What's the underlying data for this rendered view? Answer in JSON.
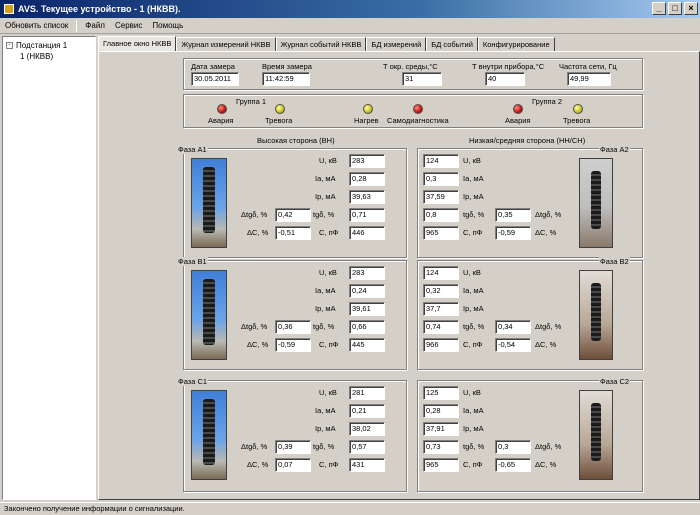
{
  "window": {
    "title": "AVS. Текущее устройство - 1 (НКВВ).",
    "buttons": [
      "_",
      "□",
      "×"
    ]
  },
  "menu": {
    "refresh": "Обновить список",
    "items": [
      "Файл",
      "Сервис",
      "Помощь"
    ]
  },
  "tree": {
    "root": "Подстанция 1",
    "root_toggle": "-",
    "child": "1 (НКВВ)"
  },
  "tabs": [
    "Главное окно НКВВ",
    "Журнал измерений НКВВ",
    "Журнал событий НКВВ",
    "БД измерений",
    "БД событий",
    "Конфигурирование"
  ],
  "header": {
    "date_label": "Дата замера",
    "date": "30.05.2011",
    "time_label": "Время замера",
    "time": "11:42:59",
    "tenv_label": "Т окр. среды,°С",
    "tenv": "31",
    "tdev_label": "Т внутри прибора,°С",
    "tdev": "40",
    "freq_label": "Частота сети, Гц",
    "freq": "49,99"
  },
  "signals": {
    "group1": "Группа 1",
    "group2": "Группа 2",
    "alarm": "Авария",
    "warning": "Тревога",
    "heating": "Нагрев",
    "selfdiag": "Самодиагностика",
    "colors": {
      "red": "#c0150e",
      "yellow": "#c8c020"
    }
  },
  "sides": {
    "high": "Высокая сторона (ВН)",
    "low": "Низкая/средняя сторона (НН/СН)"
  },
  "labels": {
    "u": "U, кВ",
    "ia": "Ia, мА",
    "ip": "Ip, мА",
    "tg": "tgδ, %",
    "c": "С, пФ",
    "dtg": "Δtgδ, %",
    "dc": "ΔС, %"
  },
  "phases": [
    {
      "hv_name": "Фаза А1",
      "lv_name": "Фаза А2",
      "hv": {
        "u": "283",
        "ia": "0,28",
        "ip": "39,63",
        "tg": "0,71",
        "c": "446",
        "dtg": "0,42",
        "dc": "-0,51"
      },
      "lv": {
        "u": "124",
        "ia": "0,3",
        "ip": "37,59",
        "tg": "0,8",
        "c": "965",
        "dtg": "0,35",
        "dc": "-0,59"
      }
    },
    {
      "hv_name": "Фаза В1",
      "lv_name": "Фаза В2",
      "hv": {
        "u": "283",
        "ia": "0,24",
        "ip": "39,61",
        "tg": "0,66",
        "c": "445",
        "dtg": "0,36",
        "dc": "-0,59"
      },
      "lv": {
        "u": "124",
        "ia": "0,32",
        "ip": "37,7",
        "tg": "0,74",
        "c": "966",
        "dtg": "0,34",
        "dc": "-0,54"
      }
    },
    {
      "hv_name": "Фаза С1",
      "lv_name": "Фаза С2",
      "hv": {
        "u": "281",
        "ia": "0,21",
        "ip": "38,02",
        "tg": "0,57",
        "c": "431",
        "dtg": "0,39",
        "dc": "0,07"
      },
      "lv": {
        "u": "125",
        "ia": "0,28",
        "ip": "37,91",
        "tg": "0,73",
        "c": "965",
        "dtg": "0,3",
        "dc": "-0,65"
      }
    }
  ],
  "status": "Закончено получение информации о сигнализации."
}
